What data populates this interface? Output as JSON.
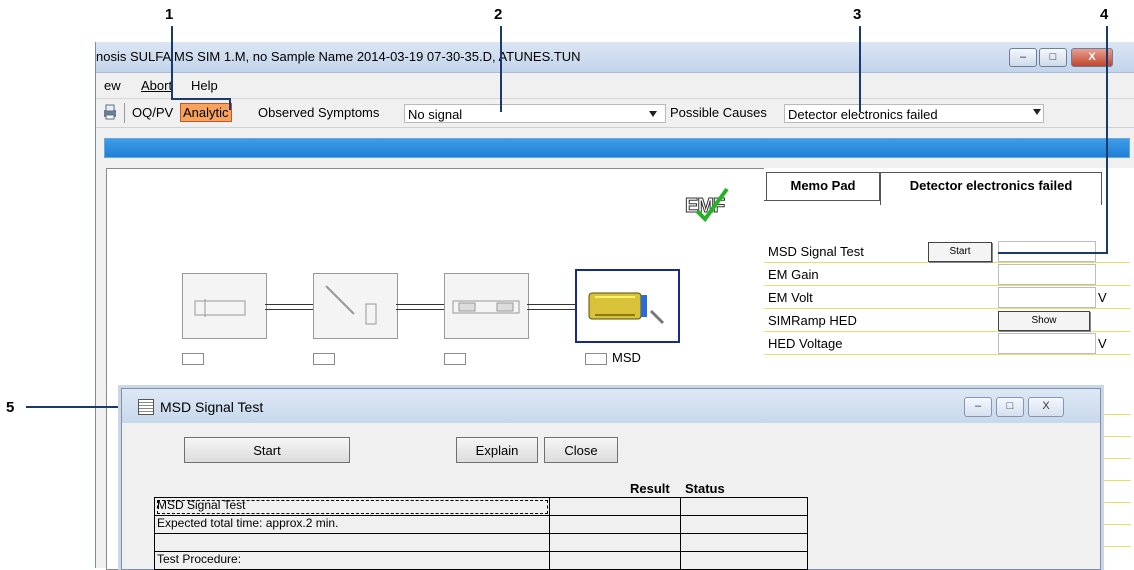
{
  "callouts": [
    "1",
    "2",
    "3",
    "4",
    "5"
  ],
  "window": {
    "title": "nosis SULFA MS SIM 1.M, no Sample Name 2014-03-19 07-30-35.D, ATUNES.TUN",
    "minimize": "–",
    "maximize": "□",
    "close": "X"
  },
  "menu": {
    "view": "ew",
    "abort": "Abort",
    "help": "Help"
  },
  "toolbar": {
    "oqpv": "OQ/PV",
    "analytic": "Analytic",
    "observed_label": "Observed Symptoms",
    "observed_value": "No signal",
    "causes_label": "Possible Causes",
    "causes_value": "Detector electronics failed"
  },
  "diagram": {
    "logo": "EMF",
    "msd_label": "MSD"
  },
  "right_panel": {
    "tabs": [
      "Memo Pad",
      "Detector electronics failed"
    ],
    "rows": [
      {
        "label": "MSD Signal Test",
        "button": "Start",
        "unit": ""
      },
      {
        "label": "EM Gain",
        "unit": ""
      },
      {
        "label": "EM Volt",
        "unit": "V"
      },
      {
        "label": "SIMRamp HED",
        "button": "Show",
        "unit": ""
      },
      {
        "label": "HED Voltage",
        "unit": "V"
      }
    ]
  },
  "dialog": {
    "title": "MSD Signal Test",
    "buttons": {
      "start": "Start",
      "explain": "Explain",
      "close": "Close"
    },
    "headers": {
      "result": "Result",
      "status": "Status"
    },
    "rows": [
      "MSD Signal Test",
      "Expected total time: approx.2 min.",
      "",
      "Test Procedure:"
    ]
  },
  "colors": {
    "analytic_highlight": "#f7a35c",
    "progress_bar": "#2e8fe0",
    "callout_line": "#1a3a6c"
  }
}
